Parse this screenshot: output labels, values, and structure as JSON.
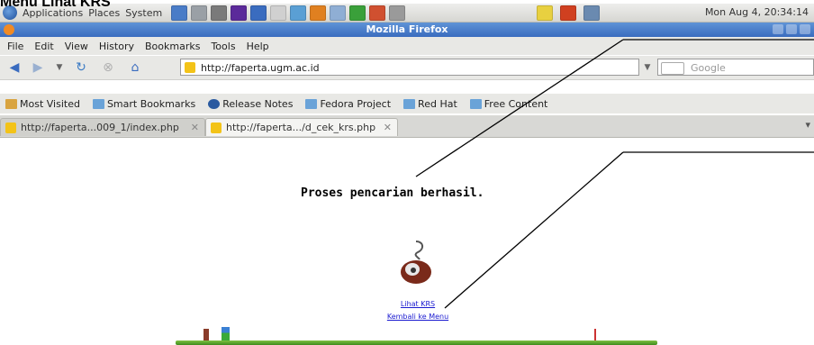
{
  "document_title": "Menu Lihat KRS",
  "panel": {
    "menus": [
      "Applications",
      "Places",
      "System"
    ],
    "tray_colors": [
      "#4a7cc7",
      "#9aa0a6",
      "#7a7a7a",
      "#5b2a9a",
      "#3a6cbf",
      "#d0d0d0",
      "#5a9fd4",
      "#e08020",
      "#8faed4",
      "#3aa03a",
      "#d05030",
      "#9a9a9a"
    ],
    "clock": "Mon Aug  4, 20:34:14"
  },
  "window": {
    "title": "Mozilla Firefox"
  },
  "menubar": [
    "File",
    "Edit",
    "View",
    "History",
    "Bookmarks",
    "Tools",
    "Help"
  ],
  "navbar": {
    "url": "http://faperta.ugm.ac.id",
    "search_placeholder": "Google"
  },
  "bookmarks": [
    "Most Visited",
    "Smart Bookmarks",
    "Release Notes",
    "Fedora Project",
    "Red Hat",
    "Free Content"
  ],
  "tabs": [
    {
      "title": "http://faperta...009_1/index.php"
    },
    {
      "title": "http://faperta.../d_cek_krs.php"
    }
  ],
  "page": {
    "message": "Proses pencarian berhasil.",
    "links": [
      "Lihat KRS",
      "Kembali ke Menu"
    ]
  }
}
